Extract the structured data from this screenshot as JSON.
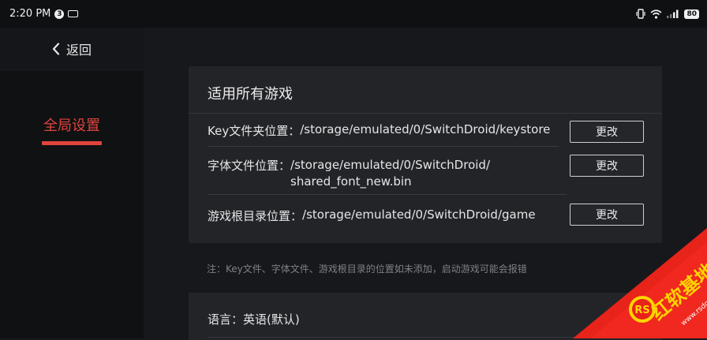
{
  "status_bar": {
    "time": "2:20 PM",
    "badge": "3",
    "battery": "80"
  },
  "sidebar": {
    "back_label": "返回",
    "items": [
      {
        "label": "全局设置",
        "active": true
      }
    ]
  },
  "settings_card": {
    "title": "适用所有游戏",
    "rows": [
      {
        "label": "Key文件夹位置：",
        "path": "/storage/emulated/0/SwitchDroid/keystore",
        "button": "更改"
      },
      {
        "label": "字体文件位置：",
        "path": "/storage/emulated/0/SwitchDroid/\nshared_font_new.bin",
        "button": "更改"
      },
      {
        "label": "游戏根目录位置：",
        "path": "/storage/emulated/0/SwitchDroid/game",
        "button": "更改"
      }
    ]
  },
  "note": "注：Key文件、字体文件、游戏根目录的位置如未添加，启动游戏可能会报错",
  "language_card": {
    "label": "语言：",
    "value": "英语(默认)"
  },
  "watermark": {
    "text": "红软基地",
    "url": "www.rsdown.cn",
    "logo": "RS"
  },
  "colors": {
    "accent": "#e0443c",
    "background": "#17181b",
    "card": "#232428",
    "sidebar": "#101113"
  }
}
